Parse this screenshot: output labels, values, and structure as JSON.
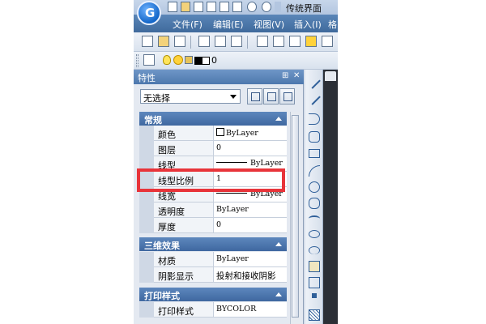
{
  "window": {
    "title": "传统界面",
    "logo_letter": "G"
  },
  "menu": {
    "items": [
      {
        "label": "文件(F)"
      },
      {
        "label": "编辑(E)"
      },
      {
        "label": "视图(V)"
      },
      {
        "label": "插入(I)"
      },
      {
        "label": "格"
      }
    ]
  },
  "layer_toolbar": {
    "current_layer": "0"
  },
  "properties": {
    "title": "特性",
    "selection": "无选择",
    "sections": [
      {
        "title": "常规",
        "rows": [
          {
            "name": "颜色",
            "value": "ByLayer"
          },
          {
            "name": "图层",
            "value": "0"
          },
          {
            "name": "线型",
            "value": "ByLayer"
          },
          {
            "name": "线型比例",
            "value": "1"
          },
          {
            "name": "线宽",
            "value": "ByLayer"
          },
          {
            "name": "透明度",
            "value": "ByLayer"
          },
          {
            "name": "厚度",
            "value": "0"
          }
        ]
      },
      {
        "title": "三维效果",
        "rows": [
          {
            "name": "材质",
            "value": "ByLayer"
          },
          {
            "name": "阴影显示",
            "value": "投射和接收阴影"
          }
        ]
      },
      {
        "title": "打印样式",
        "rows": [
          {
            "name": "打印样式",
            "value": "BYCOLOR"
          }
        ]
      }
    ]
  },
  "colors": {
    "highlight": "#e8343a",
    "section_header": "#4d78ad",
    "menubar": "#4a76a8"
  }
}
